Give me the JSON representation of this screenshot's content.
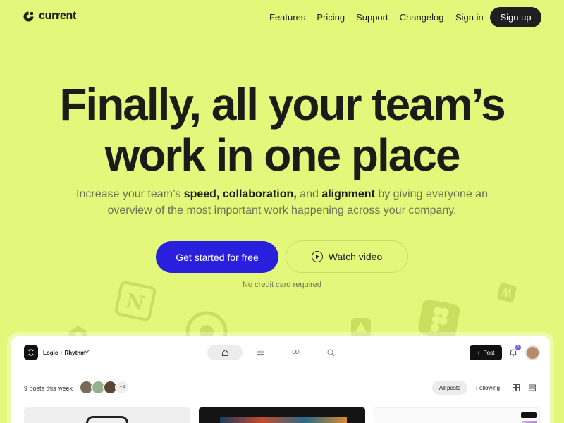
{
  "nav": {
    "brand": "current",
    "links": [
      "Features",
      "Pricing",
      "Support",
      "Changelog"
    ],
    "signin": "Sign in",
    "signup": "Sign up"
  },
  "hero": {
    "title_line1": "Finally, all your team’s",
    "title_line2": "work in one place",
    "sub_1": "Increase your team’s ",
    "sub_b1": "speed, collaboration,",
    "sub_2": " and ",
    "sub_b2": "alignment",
    "sub_3": " by giving everyone an overview of the most important work happening across your company.",
    "cta_primary": "Get started for free",
    "cta_secondary": "Watch video",
    "note": "No credit card required"
  },
  "app": {
    "workspace": "Logic + Rhythm",
    "post_label": "Post",
    "notifications": "1",
    "posts_count": "9 posts this week",
    "extra_avatars": "+4",
    "filter_all": "All posts",
    "filter_following": "Following"
  },
  "colors": {
    "background": "#e3f87b",
    "primary": "#2b1fde",
    "dark": "#1f1f1f"
  }
}
